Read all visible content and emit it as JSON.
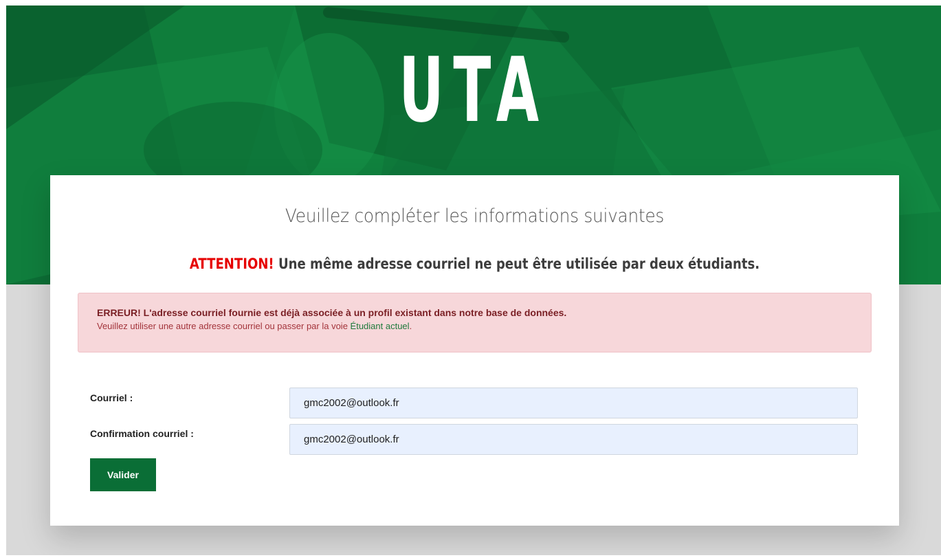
{
  "header": {
    "brand": "UTA"
  },
  "form": {
    "title": "Veuillez compléter les informations suivantes",
    "warning_prefix": "ATTENTION!",
    "warning_text": "Une même adresse courriel ne peut être utilisée par deux étudiants.",
    "error": {
      "strong": "ERREUR! L'adresse courriel fournie est déjà associée à un profil existant dans notre base de données.",
      "text_before_link": "Veuillez utiliser une autre adresse courriel ou passer par la voie ",
      "link_label": "Étudiant actuel",
      "text_after_link": "."
    },
    "fields": [
      {
        "label": "Courriel :",
        "value": "gmc2002@outlook.fr"
      },
      {
        "label": "Confirmation courriel :",
        "value": "gmc2002@outlook.fr"
      }
    ],
    "submit_label": "Valider"
  },
  "colors": {
    "brand_green": "#0f7a3c",
    "button_green": "#0a6e36",
    "attention_red": "#e60000",
    "alert_bg": "#f7d7da",
    "input_bg": "#e8f0fe"
  }
}
